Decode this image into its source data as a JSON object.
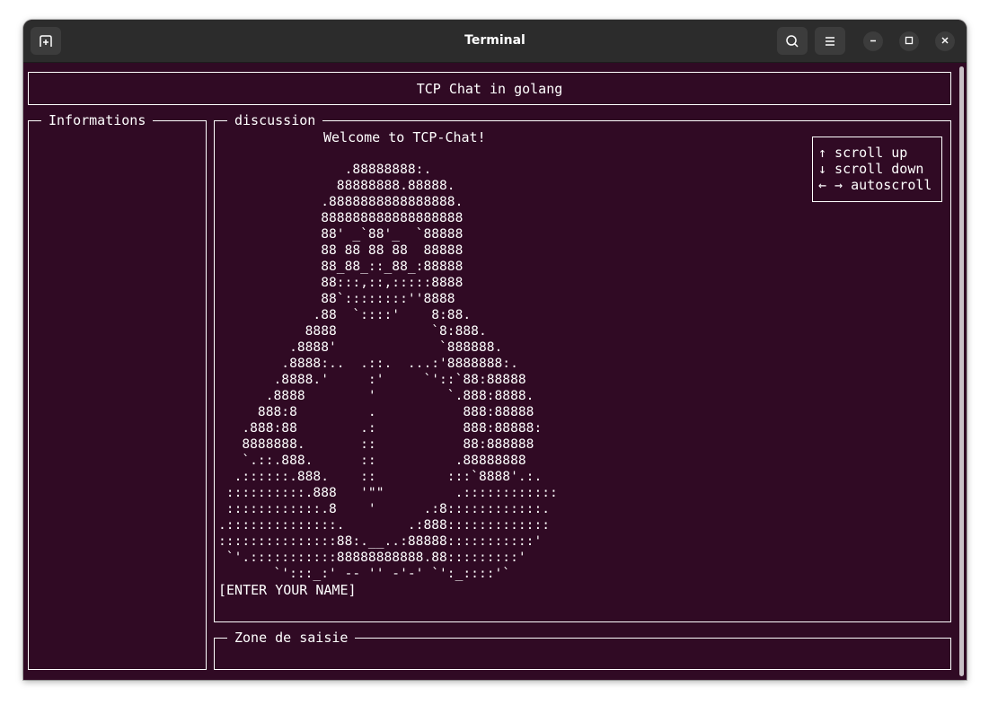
{
  "window": {
    "title": "Terminal"
  },
  "titlebar_icons": {
    "new_tab": "new-tab-icon",
    "search": "search-icon",
    "menu": "hamburger-menu-icon",
    "minimize": "minimize-icon",
    "maximize": "maximize-icon",
    "close": "close-icon"
  },
  "colors": {
    "terminal_background": "#300a24",
    "titlebar_background": "#2c2c2c",
    "foreground": "#ffffff"
  },
  "tui": {
    "header": "TCP Chat in golang",
    "info_panel": {
      "title": "Informations"
    },
    "discussion": {
      "title": "discussion",
      "welcome": "Welcome to TCP-Chat!",
      "ascii_art": [
        "                .88888888:.",
        "               88888888.88888.",
        "             .8888888888888888.",
        "             888888888888888888",
        "             88' _`88'_  `88888",
        "             88 88 88 88  88888",
        "             88_88_::_88_:88888",
        "             88:::,::,:::::8888",
        "             88`::::::::''8888",
        "            .88  `::::'    8:88.",
        "           8888            `8:888.",
        "         .8888'             `888888.",
        "        .8888:..  .::.  ...:'8888888:.",
        "       .8888.'     :'     `'::`88:88888",
        "      .8888        '         `.888:8888.",
        "     888:8         .           888:88888",
        "   .888:88        .:           888:88888:",
        "   8888888.       ::           88:888888",
        "   `.::.888.      ::          .88888888",
        "  .::::::.888.    ::         :::`8888'.:.",
        " ::::::::::.888   '\"\"         .::::::::::::",
        " ::::::::::::.8    '      .:8::::::::::::.",
        ".::::::::::::::.        .:888:::::::::::::",
        ":::::::::::::::88:.__..:88888:::::::::::'",
        " `'.:::::::::::88888888888.88:::::::::'",
        "       `':::_:' -- '' -'-' `':_::::'`"
      ],
      "prompt": "[ENTER YOUR NAME]"
    },
    "help": {
      "scroll_up": "↑ scroll up",
      "scroll_down": "↓ scroll down",
      "autoscroll": "← → autoscroll"
    },
    "input": {
      "title": "Zone de saisie",
      "value": ""
    }
  }
}
